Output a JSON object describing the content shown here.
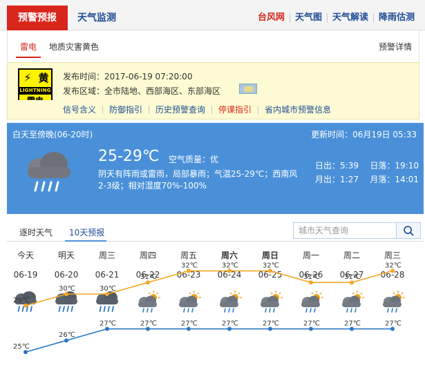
{
  "topnav": {
    "warning_tab": "预警预报",
    "monitor_tab": "天气监测",
    "links": [
      "台风网",
      "天气图",
      "天气解读",
      "降雨估测"
    ]
  },
  "subtabs": {
    "thunder": "雷电",
    "geo": "地质灾害黄色",
    "detail": "预警详情"
  },
  "warning": {
    "icon_huang": "黄",
    "icon_lightning": "LIGHTNING",
    "icon_leidian": "雷电",
    "publish_time": "发布时间：2017-06-19 07:20:00",
    "area": "发布区域：全市陆地、西部海区、东部海区",
    "links": [
      "信号含义",
      "防御指引",
      "历史预警查询",
      "停课指引",
      "省内城市预警信息"
    ]
  },
  "weather": {
    "period": "白天至傍晚(06-20时)",
    "update": "更新时间：06月19日 05:33",
    "temp": "25-29℃",
    "air_quality": "空气质量：优",
    "desc": "阴天有阵雨或雷雨，局部暴雨；气温25-29℃；西南风2-3级；相对湿度70%-100%",
    "sunrise_label": "日出：",
    "sunrise": "5:39",
    "sunset_label": "日落：",
    "sunset": "19:10",
    "moonrise_label": "月出：",
    "moonrise": "1:27",
    "moonset_label": "月落：",
    "moonset": "14:01"
  },
  "forecast_tabs": {
    "hourly": "逐时天气",
    "ten_day": "10天预报",
    "search_placeholder": "城市天气查询"
  },
  "forecast": {
    "days": [
      {
        "name": "今天",
        "date": "06-19",
        "bold": false,
        "icon": "rain-cloud-icon",
        "hi": 29,
        "lo": 25
      },
      {
        "name": "明天",
        "date": "06-20",
        "bold": false,
        "icon": "rain-cloud-icon",
        "hi": 30,
        "lo": 26
      },
      {
        "name": "周三",
        "date": "06-21",
        "bold": false,
        "icon": "rain-cloud-icon",
        "hi": 30,
        "lo": 27
      },
      {
        "name": "周四",
        "date": "06-22",
        "bold": false,
        "icon": "sun-cloud-rain-icon",
        "hi": 31,
        "lo": 27
      },
      {
        "name": "周五",
        "date": "06-23",
        "bold": false,
        "icon": "sun-cloud-rain-icon",
        "hi": 32,
        "lo": 27
      },
      {
        "name": "周六",
        "date": "06-24",
        "bold": true,
        "icon": "sun-cloud-rain-icon",
        "hi": 32,
        "lo": 27
      },
      {
        "name": "周日",
        "date": "06-25",
        "bold": true,
        "icon": "sun-cloud-rain-icon",
        "hi": 32,
        "lo": 27
      },
      {
        "name": "周一",
        "date": "06-26",
        "bold": false,
        "icon": "sun-cloud-rain-icon",
        "hi": 31,
        "lo": 27
      },
      {
        "name": "周二",
        "date": "06-27",
        "bold": false,
        "icon": "sun-cloud-rain-icon",
        "hi": 31,
        "lo": 27
      },
      {
        "name": "周三",
        "date": "06-28",
        "bold": false,
        "icon": "sun-cloud-rain-icon",
        "hi": 32,
        "lo": 27
      }
    ],
    "temp_unit": "℃",
    "high_color": "#f5a623",
    "low_color": "#2b78c5"
  },
  "chart_data": {
    "type": "line",
    "categories": [
      "06-19",
      "06-20",
      "06-21",
      "06-22",
      "06-23",
      "06-24",
      "06-25",
      "06-26",
      "06-27",
      "06-28"
    ],
    "series": [
      {
        "values": [
          29,
          30,
          30,
          31,
          32,
          32,
          32,
          31,
          31,
          32
        ]
      },
      {
        "values": [
          25,
          26,
          27,
          27,
          27,
          27,
          27,
          27,
          27,
          27
        ]
      }
    ],
    "xlabel": "",
    "ylabel": "",
    "grid": false
  }
}
